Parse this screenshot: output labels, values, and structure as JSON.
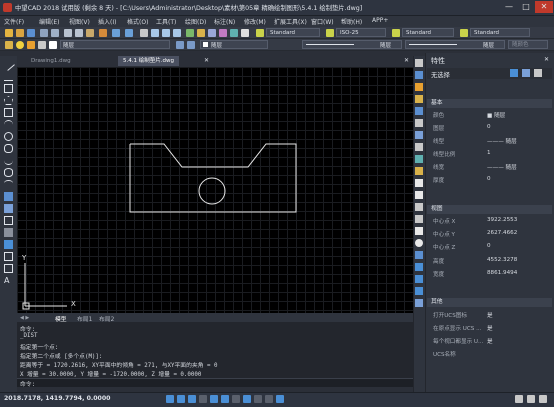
{
  "window": {
    "title": "中望CAD 2018 试用版 (剩余 8 天) - [C:\\Users\\Administrator\\Desktop\\素材\\第05章 精确绘制图形\\5.4.1 绘制垫片.dwg]",
    "minimize": "—",
    "maximize": "□",
    "close": "✕"
  },
  "menu": [
    "文件(F)",
    "编辑(E)",
    "视图(V)",
    "插入(I)",
    "格式(O)",
    "工具(T)",
    "绘图(D)",
    "标注(N)",
    "修改(M)",
    "扩展工具(X)",
    "窗口(W)",
    "帮助(H)",
    "APP+"
  ],
  "toolbar": {
    "text_style": "Standard",
    "dim_style": "ISO-25",
    "table_style": "Standard",
    "multileader_style": "Standard",
    "layer_name": "随层",
    "linetype": "随层",
    "lineweight": "随层",
    "plot_color": "随颜色"
  },
  "tabs": [
    {
      "label": "Drawing1.dwg",
      "active": false
    },
    {
      "label": "5.4.1 绘制垫片.dwg",
      "active": true
    }
  ],
  "tab_close": "✕",
  "ucs": {
    "x": "X",
    "y": "Y"
  },
  "layout_tabs": [
    "模型",
    "布局1",
    "布局2"
  ],
  "command": {
    "lines": [
      "命令:",
      "_DIST",
      "指定第一个点:",
      "指定第二个点或 [多个点(M)]:",
      "距离等于 = 1720.2616,  XY平面中的倾角 = 271,  与XY平面的夹角 = 0",
      "X 增量 = 30.0000,  Y 增量 = -1720.0000,  Z 增量 = 0.0000"
    ],
    "prompt": "命令:"
  },
  "status": {
    "coords": "2018.7178, 1419.7794, 0.0000"
  },
  "properties": {
    "title": "特性",
    "selection": "无选择",
    "sections": [
      {
        "name": "基本",
        "rows": [
          {
            "label": "颜色",
            "value": "■ 随层"
          },
          {
            "label": "图层",
            "value": "0"
          },
          {
            "label": "线型",
            "value": "——— 随层"
          },
          {
            "label": "线型比例",
            "value": "1"
          },
          {
            "label": "线宽",
            "value": "——— 随层"
          },
          {
            "label": "厚度",
            "value": "0"
          }
        ]
      },
      {
        "name": "视图",
        "rows": [
          {
            "label": "中心点 X",
            "value": "3922.2553"
          },
          {
            "label": "中心点 Y",
            "value": "2627.4662"
          },
          {
            "label": "中心点 Z",
            "value": "0"
          },
          {
            "label": "高度",
            "value": "4552.3278"
          },
          {
            "label": "宽度",
            "value": "8861.9494"
          }
        ]
      },
      {
        "name": "其他",
        "rows": [
          {
            "label": "打开UCS图标",
            "value": "是"
          },
          {
            "label": "在原点显示 UCS ...",
            "value": "是"
          },
          {
            "label": "每个视口都显示 U...",
            "value": "是"
          },
          {
            "label": "UCS名称",
            "value": ""
          }
        ]
      }
    ]
  },
  "colors": {
    "accent": "#4a8fd6",
    "drawing_lines": "#e8e8e8",
    "canvas": "#000000"
  }
}
